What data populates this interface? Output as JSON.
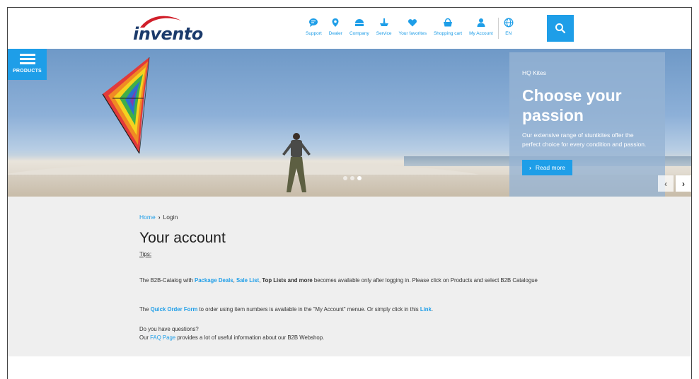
{
  "header": {
    "logo_text": "invento",
    "nav": [
      {
        "label": "Support",
        "icon": "chat-bubble-icon"
      },
      {
        "label": "Dealer",
        "icon": "map-pin-icon"
      },
      {
        "label": "Company",
        "icon": "company-icon"
      },
      {
        "label": "Service",
        "icon": "service-icon"
      },
      {
        "label": "Your favorites",
        "icon": "heart-icon"
      },
      {
        "label": "Shopping cart",
        "icon": "shopping-basket-icon"
      },
      {
        "label": "My Account",
        "icon": "user-icon"
      },
      {
        "label": "EN",
        "icon": "globe-icon"
      }
    ],
    "search_icon": "search-icon"
  },
  "hero": {
    "products_label": "PRODUCTS",
    "eyebrow": "HQ Kites",
    "title": "Choose your passion",
    "description": "Our extensive range of stuntkites offer the perfect choice for every condition and passion.",
    "read_more_label": "Read more",
    "read_more_arrow": "›",
    "slide_count": 3,
    "active_slide": 3,
    "prev_arrow": "‹",
    "next_arrow": "›"
  },
  "breadcrumb": {
    "home": "Home",
    "separator": "›",
    "current": "Login"
  },
  "page": {
    "title": "Your account",
    "tips_label": "Tips:",
    "p1_a": "The B2B-Catalog with ",
    "p1_link1": "Package Deals",
    "p1_b": ", ",
    "p1_link2": "Sale List",
    "p1_c": ", ",
    "p1_bold": "Top Lists and more",
    "p1_d": " becomes available only after logging in. Please click on Products and select B2B Catalogue",
    "p2_a": "The ",
    "p2_link1": "Quick Order Form",
    "p2_b": " to order using item numbers is available in the \"My Account\" menue. Or simply click in this ",
    "p2_link2": "Link",
    "p2_c": ".",
    "p3_line1": "Do you have questions?",
    "p3_a": "Our ",
    "p3_link": "FAQ Page",
    "p3_b": " provides a lot of useful information about our B2B Webshop."
  },
  "colors": {
    "accent": "#1e9ee8",
    "logo": "#1b3a6b",
    "logo_swoosh": "#d11f2a",
    "content_bg": "#efefef"
  }
}
